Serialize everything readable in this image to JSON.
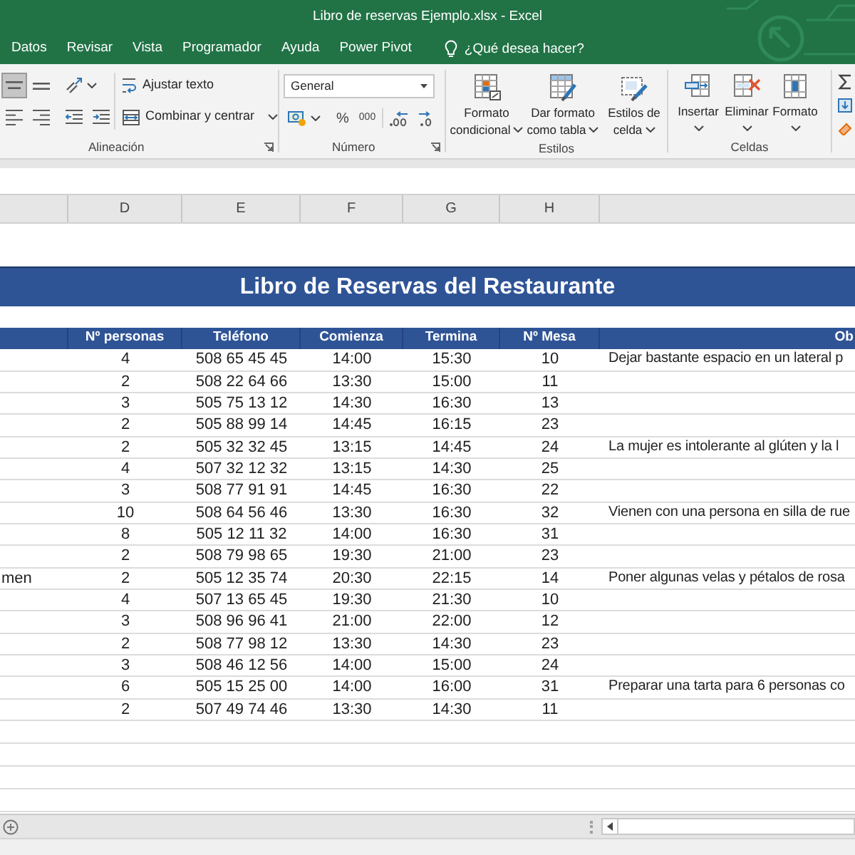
{
  "window": {
    "title": "Libro de reservas Ejemplo.xlsx - Excel"
  },
  "ribbon_tabs": [
    {
      "label": "Datos",
      "selected": false
    },
    {
      "label": "Revisar",
      "selected": false
    },
    {
      "label": "Vista",
      "selected": false
    },
    {
      "label": "Programador",
      "selected": false
    },
    {
      "label": "Ayuda",
      "selected": false
    },
    {
      "label": "Power Pivot",
      "selected": false
    }
  ],
  "tell_me": {
    "placeholder": "¿Qué desea hacer?"
  },
  "ribbon": {
    "alignment": {
      "label": "Alineación",
      "align_buttons": [
        {
          "selected": true
        },
        {
          "selected": false
        },
        {
          "selected": false
        },
        {
          "selected": false
        }
      ],
      "wrap_text": "Ajustar texto",
      "merge_center": "Combinar y centrar"
    },
    "number": {
      "label": "Número",
      "format": {
        "value": "General"
      },
      "percent": "%",
      "thousands": "000"
    },
    "styles": {
      "label": "Estilos",
      "buttons": [
        {
          "lines": [
            "Formato",
            "condicional"
          ]
        },
        {
          "lines": [
            "Dar formato",
            "como tabla"
          ]
        },
        {
          "lines": [
            "Estilos de",
            "celda"
          ]
        }
      ]
    },
    "cells": {
      "label": "Celdas",
      "buttons": [
        {
          "label": "Insertar"
        },
        {
          "label": "Eliminar"
        },
        {
          "label": "Formato"
        }
      ]
    }
  },
  "sheet": {
    "column_headers": [
      "D",
      "E",
      "F",
      "G",
      "H"
    ],
    "title": "Libro de Reservas del Restaurante",
    "table": {
      "columns": [
        "Nº personas",
        "Teléfono",
        "Comienza",
        "Termina",
        "Nº Mesa",
        "Ob"
      ],
      "rows": [
        {
          "party_size": "4",
          "phone": "508 65 45 45",
          "start": "14:00",
          "end": "15:30",
          "table": "10",
          "notes": "Dejar bastante espacio en un lateral p"
        },
        {
          "party_size": "2",
          "phone": "508 22 64 66",
          "start": "13:30",
          "end": "15:00",
          "table": "11"
        },
        {
          "party_size": "3",
          "phone": "505 75 13 12",
          "start": "14:30",
          "end": "16:30",
          "table": "13"
        },
        {
          "party_size": "2",
          "phone": "505 88 99 14",
          "start": "14:45",
          "end": "16:15",
          "table": "23"
        },
        {
          "party_size": "2",
          "phone": "505 32 32 45",
          "start": "13:15",
          "end": "14:45",
          "table": "24",
          "notes": "La mujer es intolerante al glúten y la l"
        },
        {
          "party_size": "4",
          "phone": "507 32 12 32",
          "start": "13:15",
          "end": "14:30",
          "table": "25"
        },
        {
          "party_size": "3",
          "phone": "508 77 91 91",
          "start": "14:45",
          "end": "16:30",
          "table": "22"
        },
        {
          "party_size": "10",
          "phone": "508 64 56 46",
          "start": "13:30",
          "end": "16:30",
          "table": "32",
          "notes": "Vienen con una persona en silla de rue"
        },
        {
          "party_size": "8",
          "phone": "505 12 11 32",
          "start": "14:00",
          "end": "16:30",
          "table": "31"
        },
        {
          "party_size": "2",
          "phone": "508 79 98 65",
          "start": "19:30",
          "end": "21:00",
          "table": "23"
        },
        {
          "column_c": "men",
          "party_size": "2",
          "phone": "505 12 35 74",
          "start": "20:30",
          "end": "22:15",
          "table": "14",
          "notes": "Poner algunas velas y pétalos de rosa"
        },
        {
          "party_size": "4",
          "phone": "507 13 65 45",
          "start": "19:30",
          "end": "21:30",
          "table": "10"
        },
        {
          "party_size": "3",
          "phone": "508 96 96 41",
          "start": "21:00",
          "end": "22:00",
          "table": "12"
        },
        {
          "party_size": "2",
          "phone": "508 77 98 12",
          "start": "13:30",
          "end": "14:30",
          "table": "23"
        },
        {
          "party_size": "3",
          "phone": "508 46 12 56",
          "start": "14:00",
          "end": "15:00",
          "table": "24"
        },
        {
          "party_size": "6",
          "phone": "505 15 25 00",
          "start": "14:00",
          "end": "16:00",
          "table": "31",
          "notes": "Preparar una tarta para 6 personas co"
        },
        {
          "party_size": "2",
          "phone": "507 49 74 46",
          "start": "13:30",
          "end": "14:30",
          "table": "11"
        }
      ]
    }
  }
}
